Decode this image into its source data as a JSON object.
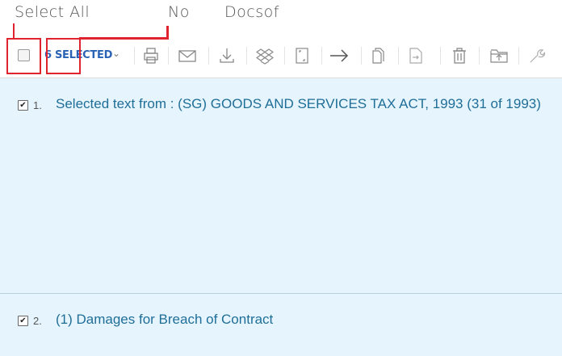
{
  "annotations": {
    "select_all": "Select All",
    "no": "No",
    "docsof": "Docsof",
    "callout_color": "#e0242f"
  },
  "toolbar": {
    "selected_label": "6 SELECTED",
    "dropdown_icon": "chevron-down-icon",
    "icons": [
      "print-icon",
      "email-icon",
      "download-icon",
      "dropbox-icon",
      "export-doc-icon",
      "send-to-icon",
      "copy-icon",
      "move-doc-icon",
      "delete-icon",
      "save-to-folder-icon",
      "tools-icon"
    ]
  },
  "results": [
    {
      "checked": true,
      "number": "1.",
      "title": "Selected text from : (SG) GOODS AND SERVICES TAX ACT, 1993 (31 of 1993)"
    },
    {
      "checked": true,
      "number": "2.",
      "title": "(1) Damages for Breach of Contract"
    }
  ],
  "colors": {
    "accent": "#2a63b5",
    "result_bg": "#e6f5fd",
    "result_title": "#1f6e98"
  }
}
